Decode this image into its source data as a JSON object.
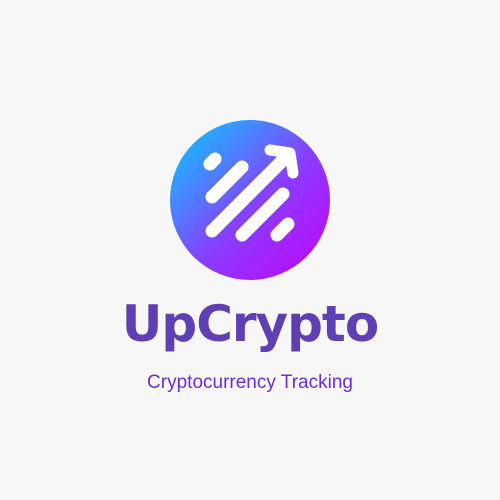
{
  "logo": {
    "icon": "rising-arrow-stripes-icon",
    "gradient_start": "#00d2ff",
    "gradient_end": "#c600ff",
    "stripe_color": "#ffffff"
  },
  "brand": {
    "name": "UpCrypto",
    "tagline": "Cryptocurrency Tracking",
    "name_color": "#5f3fb4",
    "tagline_color": "#6a2fd6"
  }
}
